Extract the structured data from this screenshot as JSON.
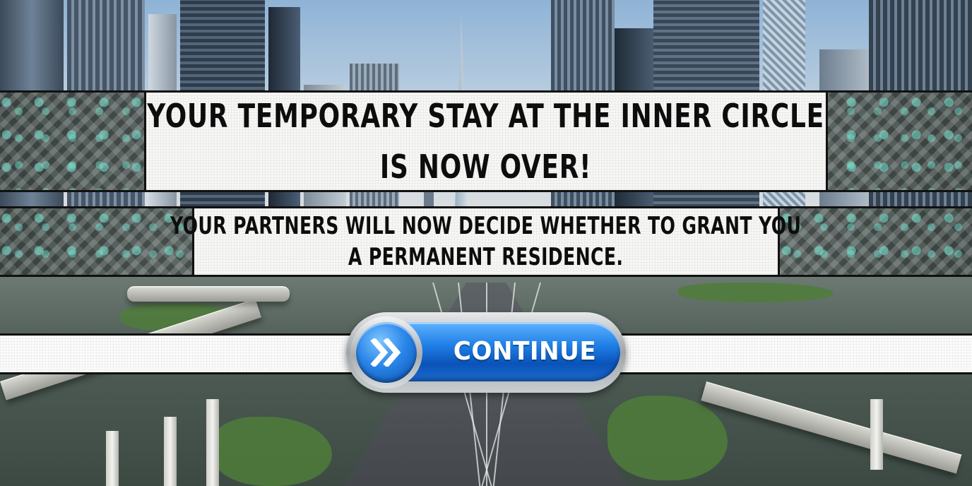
{
  "overlay": {
    "title_lines": [
      "YOUR TEMPORARY STAY AT THE INNER CIRCLE",
      "IS NOW OVER!"
    ],
    "subtitle_lines": [
      "YOUR PARTNERS WILL NOW DECIDE WHETHER TO GRANT YOU",
      "A PERMANENT RESIDENCE."
    ]
  },
  "continue_button": {
    "label": "CONTINUE",
    "icon": "double-chevron-right-icon"
  },
  "background": {
    "description_icon": "futuristic-city-skyline",
    "colors": {
      "button_blue": "#1f7fe6",
      "accent_teal": "#78e6d2",
      "panel_white": "#f7f7f5"
    }
  }
}
